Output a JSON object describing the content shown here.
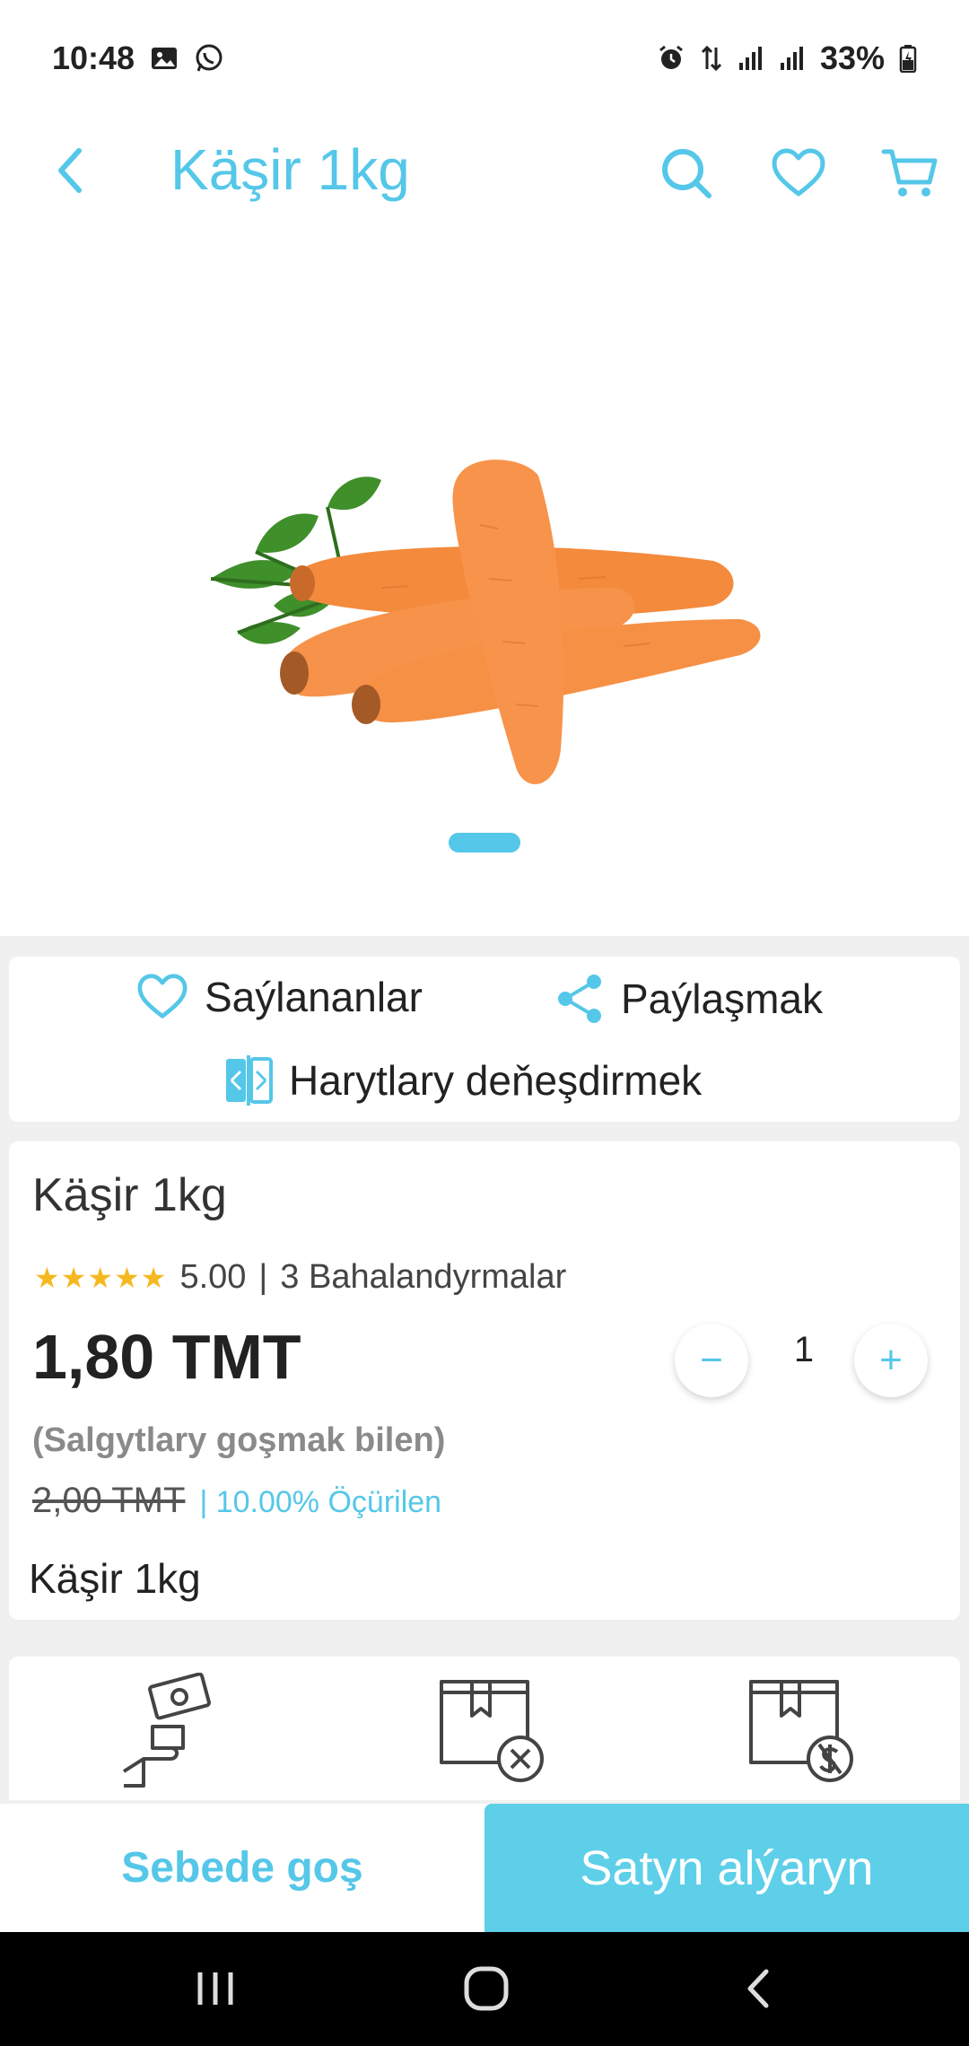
{
  "status_bar": {
    "time": "10:48",
    "battery": "33%",
    "icons": [
      "gallery-icon",
      "whatsapp-icon",
      "alarm-icon",
      "data-transfer-icon",
      "signal-icon",
      "signal-icon",
      "battery-icon"
    ]
  },
  "header": {
    "title": "Käşir 1kg",
    "icons": [
      "back-arrow-icon",
      "search-icon",
      "heart-icon",
      "cart-icon"
    ]
  },
  "gallery": {
    "image_name": "carrots-image",
    "pager_count": 1,
    "active_index": 0
  },
  "actions": {
    "favorites_label": "Saýlananlar",
    "share_label": "Paýlaşmak",
    "compare_label": "Harytlary deňeşdirmek"
  },
  "product": {
    "title": "Käşir 1kg",
    "stars": "★★★★★",
    "rating_value": "5.00",
    "rating_separator": "|",
    "reviews_label": "3 Bahalandyrmalar",
    "price": "1,80 TMT",
    "quantity": "1",
    "qty_minus": "−",
    "qty_plus": "+",
    "tax_note": "(Salgytlary goşmak bilen)",
    "old_price": "2,00 TMT",
    "discount_label": "| 10.00% Öçürilen",
    "description": "Käşir 1kg"
  },
  "features": {
    "icons": [
      "cash-on-delivery-icon",
      "no-return-box-icon",
      "no-refund-box-icon"
    ]
  },
  "bottom_bar": {
    "add_to_cart_label": "Sebede goş",
    "buy_now_label": "Satyn alýaryn"
  },
  "colors": {
    "accent": "#55c7e8",
    "buy_button": "#5ecfe8",
    "stars": "#f5b820"
  }
}
